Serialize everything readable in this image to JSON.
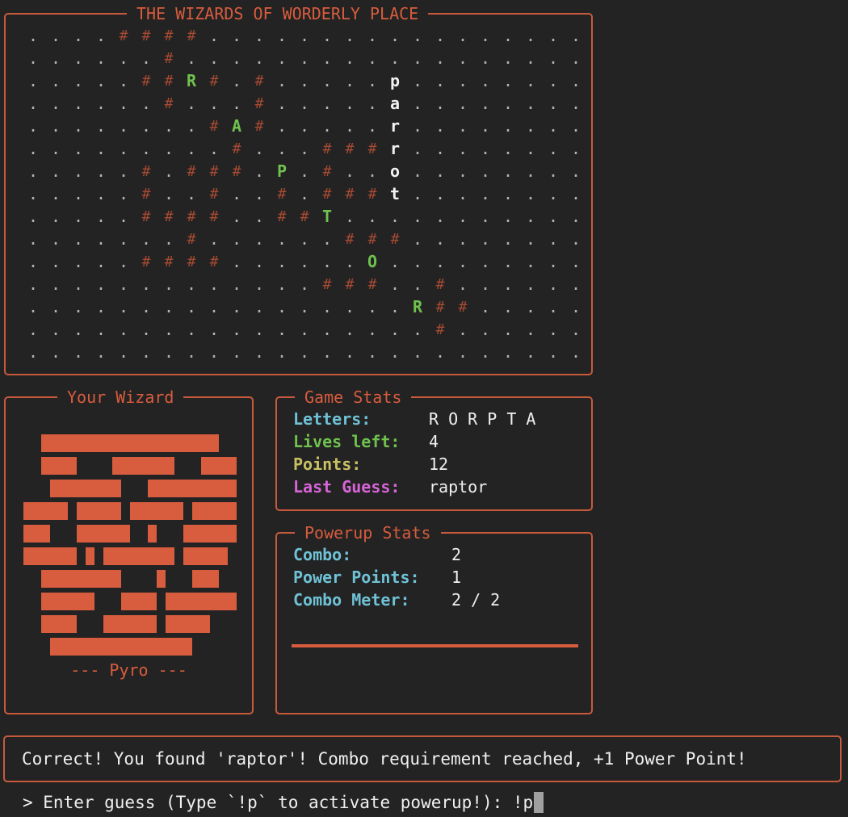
{
  "board": {
    "title": "THE WIZARDS OF WORDERLY PLACE",
    "rows": [
      ". . . . # # # # . . . . . . . . . . . . . . . . .",
      ". . . . . . # . . . . . . . . . . . . . . . . . .",
      ". . . . . # # R # . # . . . . . p . . . . . . . .",
      ". . . . . . # . . . # . . . . . a . . . . . . . .",
      ". . . . . . . . # A # . . . . . r . . . . . . . .",
      ". . . . . . . . . # . . . # # # r . . . . . . . .",
      ". . . . . # . # # # . P . # . . o . . . . . . . .",
      ". . . . . # . . # . . # . # # # t . . . . . . . .",
      ". . . . . # # # # . . # # T . . . . . . . . . . .",
      ". . . . . . . # . . . . . . # # # . . . . . . . .",
      ". . . . . # # # # . . . . . . O . . . . . . . . .",
      ". . . . . . . . . . . . . # # # . . # . . . . . .",
      ". . . . . . . . . . . . . . . . . R # # . . . . .",
      ". . . . . . . . . . . . . . . . . . # . . . . . .",
      ". . . . . . . . . . . . . . . . . . . . . . . . ."
    ],
    "found_cells": [
      [
        2,
        7
      ],
      [
        4,
        9
      ],
      [
        6,
        11
      ],
      [
        8,
        13
      ],
      [
        10,
        15
      ],
      [
        12,
        17
      ]
    ],
    "word_cells": [
      [
        2,
        16
      ],
      [
        3,
        16
      ],
      [
        4,
        16
      ],
      [
        5,
        16
      ],
      [
        6,
        16
      ],
      [
        7,
        16
      ]
    ],
    "colors": {
      "dot": "#b4b4b4",
      "wall": "#a64a33",
      "found": "#70c24e",
      "word": "#f2f2f2"
    }
  },
  "wizard": {
    "title": "Your Wizard",
    "name_label": "--- Pyro ---",
    "art": [
      "  ████████████████████  ",
      "  ████    ███████   ████",
      "   ████████   ██████████",
      "█████ █████ ██████ █████",
      "███   ██████  █   ██████",
      "██████ █ ████████ █████ ",
      "  █████████    █   ███  ",
      "  ██████   ████ ████████",
      "  ████   ██████ █████   ",
      "   ████████████████     "
    ],
    "art_color": "#d85c3e"
  },
  "stats": {
    "title": "Game Stats",
    "letters_label": "Letters:",
    "letters_value": "R O R P T A",
    "lives_label": "Lives left:",
    "lives_value": "4",
    "points_label": "Points:",
    "points_value": "12",
    "last_guess_label": "Last Guess:",
    "last_guess_value": "raptor"
  },
  "powerup": {
    "title": "Powerup Stats",
    "combo_label": "Combo:",
    "combo_value": "2",
    "power_points_label": "Power Points:",
    "power_points_value": "1",
    "combo_meter_label": "Combo Meter:",
    "combo_meter_value": "2 / 2",
    "combo_meter_fraction": 1.0
  },
  "message": {
    "text": "Correct! You found 'raptor'! Combo requirement reached, +1 Power Point!"
  },
  "prompt": {
    "text": "> Enter guess (Type `!p` to activate powerup!): ",
    "input_value": "!p"
  }
}
